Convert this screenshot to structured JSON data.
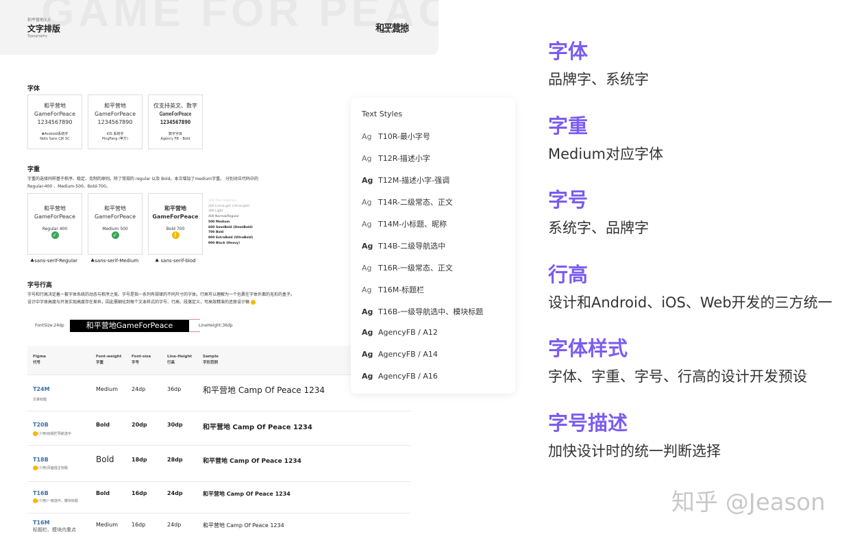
{
  "header": {
    "version": "和平营地3.0",
    "title": "文字排版",
    "subtitle": "Typography",
    "watermark": "GAME FOR PEACE",
    "logo": "和平营地",
    "logo_sub": "CAMPS OF PEACE"
  },
  "fonts": {
    "title": "字体",
    "cards": [
      {
        "l1": "和平营地",
        "l2": "GameForPeace",
        "l3": "1234567890",
        "n1": "Android系统字",
        "n2": "Noto Sans CJK SC",
        "icon": "android-icon"
      },
      {
        "l1": "和平营地",
        "l2": "GameForPeace",
        "l3": "1234567890",
        "n1": "iOS 系统字",
        "n2": "PingFang (苹方)",
        "icon": "apple-icon"
      },
      {
        "l1": "仅支持英文、数字",
        "l2": "GameForPeace",
        "l3": "1234567890",
        "n1": "数字字体",
        "n2": "Agency  FB – Bold"
      }
    ]
  },
  "weight": {
    "title": "字重",
    "desc1": "字重的选择同样基于秩序、稳定、克制的原则。除了常规的 regular 以及 Bold。本次增加了medium字重。 分别对应代码中的",
    "desc2": "Regular-400 、Medium-500、Bold-700。",
    "cards": [
      {
        "l1": "和平营地",
        "l2": "GameForPeace",
        "w": "Regular 400",
        "status": "✓",
        "foot": "sans-serif-Regular"
      },
      {
        "l1": "和平营地",
        "l2": "GameForPeace",
        "w": "Medium 500",
        "status": "✓",
        "foot": "sans-serif-Medium"
      },
      {
        "l1": "和平营地",
        "l2": "GameForPeace",
        "w": "Bold 700",
        "status": "!",
        "foot": "sans-serif-blod"
      }
    ],
    "list": [
      "100 Thin (Hairline)",
      "200 ExtraLight (UltraLight)",
      "300 Light",
      "400 Normal/Regular",
      "500 Medium",
      "600 SemiBold (DemiBold)",
      "700 Bold",
      "800 ExtraBold (UltraBold)",
      "900 Black (Heavy)"
    ]
  },
  "size": {
    "title": "字号行高",
    "desc1": "字号和行高决定着一套字体系统的动态与秩序之美。字号是指一系列有规律的不同尺寸的字体。行高可以理解为一个包裹在字体外面的无形的盒子。",
    "desc2": "设计中字体高度与开发实现高度存在差异，因此需细化到每个文本样式的字号、行高、段落定义，可高效精准的还原设计稿",
    "fontsize": "FontSize:24dp",
    "sample": "和平营地GameForPeace",
    "lineheight": "LineHeight:36dp"
  },
  "table": {
    "headers": [
      [
        "Figma",
        "代号"
      ],
      [
        "Font-weight",
        "字重"
      ],
      [
        "Font-size",
        "字号"
      ],
      [
        "Line-Height",
        "行高"
      ],
      [
        "Sample",
        "字形范例"
      ]
    ],
    "rows": [
      {
        "code": "T24M",
        "desc": "文章标题",
        "w": "Medium",
        "fs": "24dp",
        "lh": "36dp",
        "sample": "和平营地 Camp Of Peace 1234"
      },
      {
        "code": "T20B",
        "desc": "(少用)标题栏导航选中",
        "w": "Bold",
        "fs": "20dp",
        "lh": "30dp",
        "sample": "和平营地 Camp Of Peace 1234"
      },
      {
        "code": "T18B",
        "desc": "(少用)页面强主标题",
        "w": "Bold",
        "fs": "18dp",
        "lh": "28dp",
        "sample": "和平营地 Camp Of Peace 1234"
      },
      {
        "code": "T16B",
        "desc": "(少用)一级选中，模块标题",
        "w": "Bold",
        "fs": "16dp",
        "lh": "24dp",
        "sample": "和平营地 Camp Of Peace 1234"
      },
      {
        "code": "T16M",
        "desc": "标题栏、模块内重点",
        "w": "Medium",
        "fs": "16dp",
        "lh": "24dp",
        "sample": "和平营地 Camp Of Peace 1234"
      }
    ]
  },
  "text_styles": {
    "title": "Text Styles",
    "ag": "Ag",
    "items": [
      "T10R-最小字号",
      "T12R-描述小字",
      "T12M-描述小字-强调",
      "T14R-二级常态、正文",
      "T14M-小标题、昵称",
      "T14B-二级导航选中",
      "T16R-一级常态、正文",
      "T16M-标题栏",
      "T16B-一级导航选中、模块标题",
      "AgencyFB / A12",
      "AgencyFB / A14",
      "AgencyFB / A16"
    ]
  },
  "right": [
    {
      "t": "字体",
      "s": "品牌字、系统字"
    },
    {
      "t": "字重",
      "s": "Medium对应字体"
    },
    {
      "t": "字号",
      "s": "系统字、品牌字"
    },
    {
      "t": "行高",
      "s": "设计和Android、iOS、Web开发的三方统一"
    },
    {
      "t": "字体样式",
      "s": "字体、字重、字号、行高的设计开发预设"
    },
    {
      "t": "字号描述",
      "s": "加快设计时的统一判断选择"
    }
  ],
  "watermark": "知乎 @Jeason",
  "colors": {
    "accent": "#7b5cf0",
    "link": "#3a6ea5"
  }
}
